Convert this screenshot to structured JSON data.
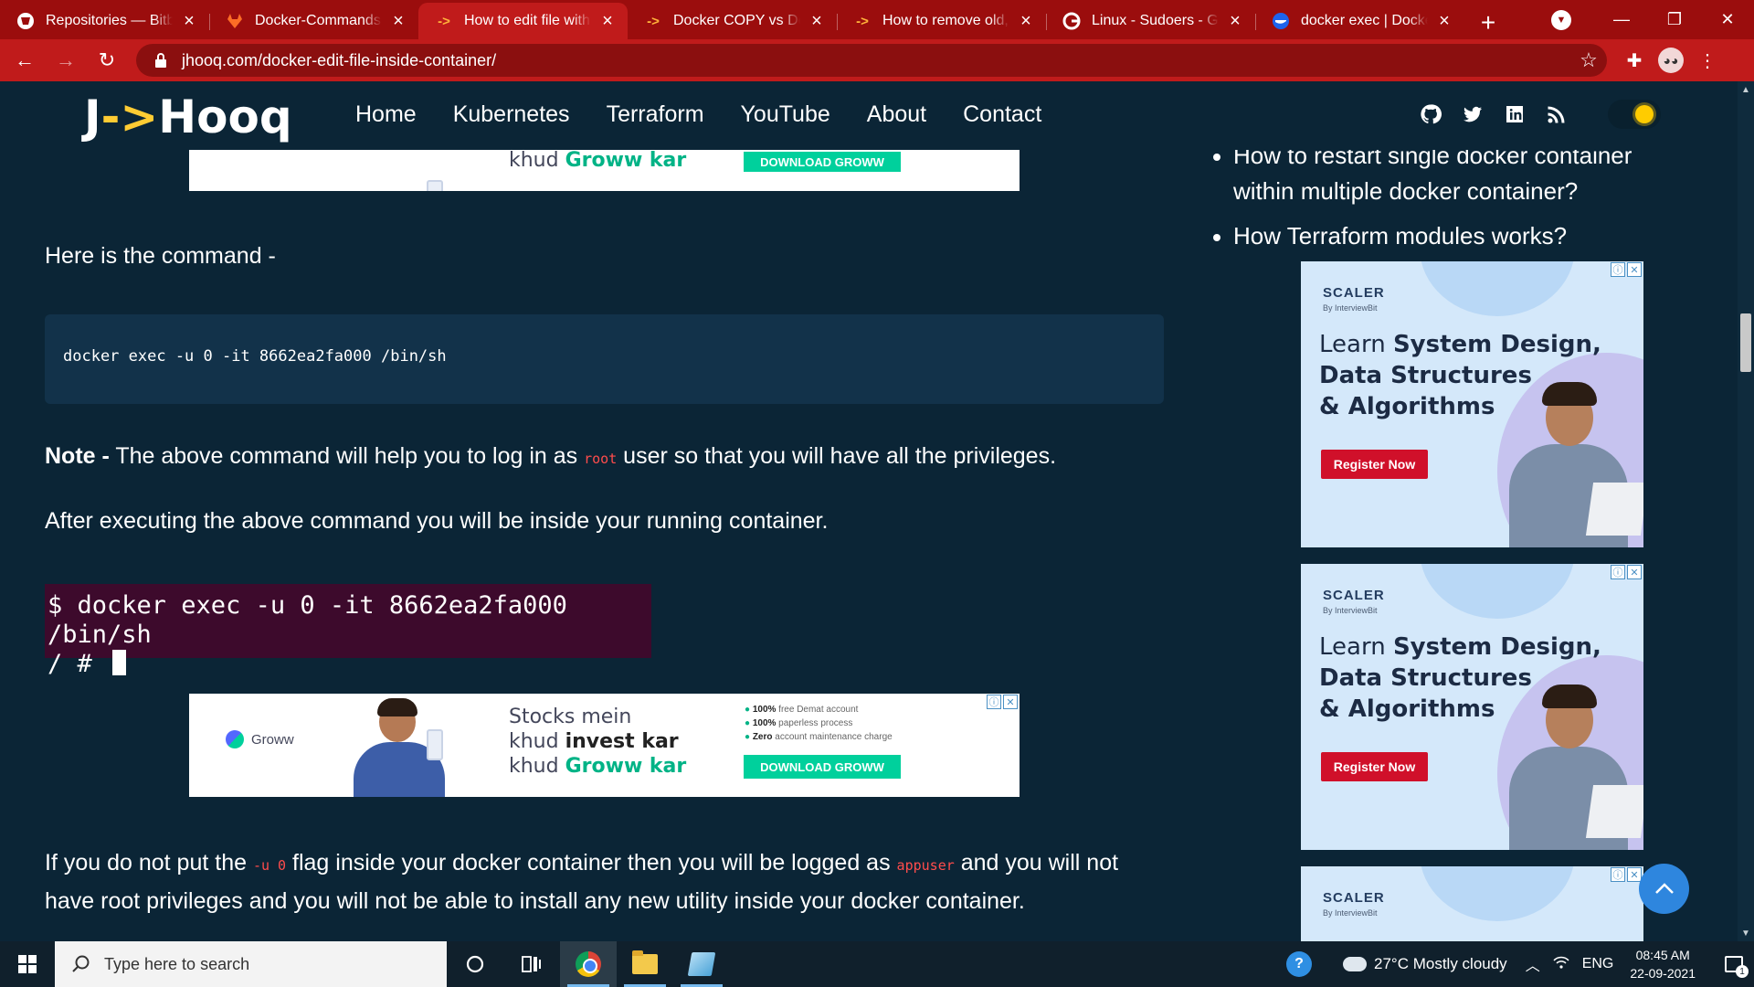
{
  "browser": {
    "tabs": [
      {
        "title": "Repositories — Bitbucket",
        "favicon": "bitbucket-icon"
      },
      {
        "title": "Docker-Commands · GitLab",
        "favicon": "gitlab-icon"
      },
      {
        "title": "How to edit file within Docker container",
        "favicon": "jhooq-icon",
        "active": true
      },
      {
        "title": "Docker COPY vs Docker ADD",
        "favicon": "jhooq-icon"
      },
      {
        "title": "How to remove old, unused images",
        "favicon": "jhooq-icon"
      },
      {
        "title": "Linux - Sudoers - Google Search",
        "favicon": "google-icon"
      },
      {
        "title": "docker exec | Docker Documentation",
        "favicon": "docker-icon"
      }
    ],
    "url": "jhooq.com/docker-edit-file-inside-container/",
    "favicon_arrow": "->"
  },
  "site": {
    "logo_prefix": "J",
    "logo_arrow": "->",
    "logo_suffix": "Hooq",
    "menu": [
      "Home",
      "Kubernetes",
      "Terraform",
      "YouTube",
      "About",
      "Contact"
    ],
    "social_icons": [
      "github-icon",
      "twitter-icon",
      "linkedin-icon",
      "rss-icon"
    ]
  },
  "article": {
    "intro": "Here is the command -",
    "code": "docker exec -u 0 -it 8662ea2fa000 /bin/sh",
    "note_label": "Note -",
    "note_before": " The above command will help you to log in as ",
    "note_code": "root",
    "note_after": " user so that you will have all the privileges.",
    "after_exec": "After executing the above command you will be inside your running container.",
    "terminal_line1": "$ docker exec -u 0 -it 8662ea2fa000 /bin/sh",
    "terminal_line2": "/ # ",
    "para_before": "If you do not put the ",
    "para_code1": "-u 0",
    "para_mid": " flag inside your docker container then you will be logged as ",
    "para_code2": "appuser",
    "para_after": " and you will not have root privileges and you will not be able to install any new utility inside your docker container."
  },
  "sidebar": {
    "links": [
      "How to restart single docker container within multiple docker container?",
      "How Terraform modules works?"
    ]
  },
  "ads": {
    "groww": {
      "logo": "Groww",
      "line1": "Stocks mein",
      "line2_a": "khud ",
      "line2_b": "invest kar",
      "line3_a": "khud ",
      "line3_b": "Groww kar",
      "points": [
        {
          "bold": "100%",
          "text": " free Demat account"
        },
        {
          "bold": "100%",
          "text": " paperless process"
        },
        {
          "bold": "Zero",
          "text": " account maintenance charge"
        }
      ],
      "cta": "DOWNLOAD GROWW",
      "choices_info": "ⓘ",
      "choices_close": "✕"
    },
    "scaler": {
      "brand": "SCALER",
      "sub": "By InterviewBit",
      "learn": "Learn ",
      "line1_b": "System Design,",
      "line2": "Data Structures",
      "line3": "& Algorithms",
      "cta": "Register Now"
    }
  },
  "taskbar": {
    "search_placeholder": "Type here to search",
    "weather": "27°C  Mostly cloudy",
    "lang": "ENG",
    "time": "08:45 AM",
    "date": "22-09-2021",
    "notif_count": "1"
  }
}
